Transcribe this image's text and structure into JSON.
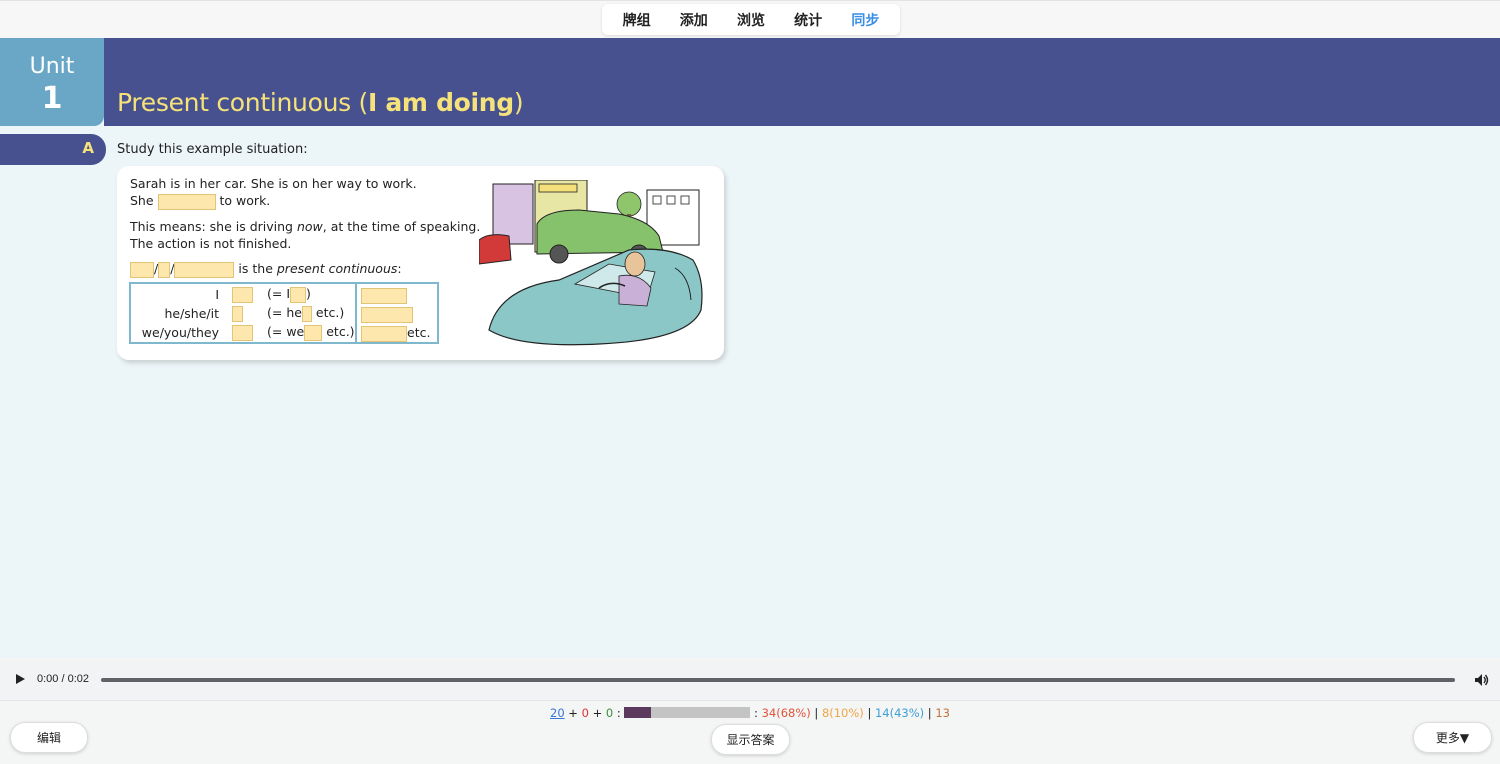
{
  "nav": {
    "items": [
      {
        "label": "牌组"
      },
      {
        "label": "添加"
      },
      {
        "label": "浏览"
      },
      {
        "label": "统计"
      },
      {
        "label": "同步"
      }
    ],
    "active_index": 4
  },
  "unit": {
    "word": "Unit",
    "number": "1",
    "title_prefix": "Present continuous (",
    "title_bold": "I am doing",
    "title_suffix": ")"
  },
  "section": {
    "letter": "A",
    "intro": "Study this example situation:"
  },
  "example": {
    "line1": "Sarah is in her car.  She is on her way to work.",
    "line2_pre": "She",
    "line2_post": "to work.",
    "line3_pre": "This means: she is driving ",
    "line3_em": "now",
    "line3_post": ", at the time of speaking.",
    "line4": "The action is not finished.",
    "line5_post": "is the ",
    "line5_em": "present continuous",
    "line5_end": ":",
    "table": {
      "rows": [
        {
          "pronoun": "I",
          "contr_pre": "(= I",
          "contr_post": ")",
          "ing_post": ""
        },
        {
          "pronoun": "he/she/it",
          "contr_pre": "(= he",
          "contr_post": " etc.)",
          "ing_post": ""
        },
        {
          "pronoun": "we/you/they",
          "contr_pre": "(= we",
          "contr_post": " etc.)",
          "ing_post": "etc."
        }
      ]
    }
  },
  "audio": {
    "time": "0:00 / 0:02"
  },
  "stats": {
    "new": "20",
    "plus1": " + ",
    "learn": "0",
    "plus2": " + ",
    "review": "0",
    "colon": " : ",
    "bar_fraction": 0.21,
    "after_bar": " : ",
    "red": "34(68%)",
    "sep1": " | ",
    "orange": "8(10%)",
    "sep2": " | ",
    "blue": "14(43%)",
    "sep3": " | ",
    "last": "13"
  },
  "buttons": {
    "edit": "编辑",
    "show_answer": "显示答案",
    "more": "更多▼"
  }
}
